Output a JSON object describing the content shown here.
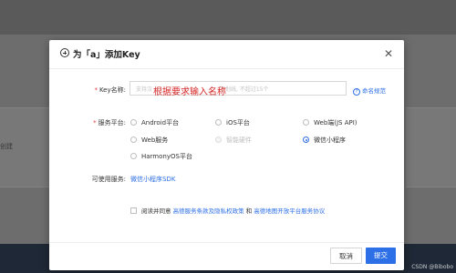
{
  "background": {
    "left_text": "创建"
  },
  "modal": {
    "title": "为「a」添加Key",
    "key_name": {
      "label": "Key名称:",
      "placeholder": "支持汉",
      "placeholder_tail": "下划线, 不超过15个",
      "overlay": "根据要求输入名称",
      "rule_link": "命名规范"
    },
    "platform": {
      "label": "服务平台:",
      "options": [
        {
          "label": "Android平台"
        },
        {
          "label": "iOS平台"
        },
        {
          "label": "Web端(JS API)"
        },
        {
          "label": "Web服务"
        },
        {
          "label": "智能硬件"
        },
        {
          "label": "微信小程序"
        },
        {
          "label": "HarmonyOS平台"
        }
      ],
      "selected": "微信小程序"
    },
    "available": {
      "label": "可使用服务:",
      "value": "微信小程序SDK"
    },
    "agreement": {
      "prefix": "阅读并同意",
      "link1": "高德服务条款及隐私权政策",
      "and": "和",
      "link2": "高德地图开放平台服务协议"
    },
    "buttons": {
      "cancel": "取消",
      "submit": "提交"
    }
  },
  "watermark": "CSDN @Bibobo",
  "colors": {
    "primary": "#2d6fe6",
    "required": "#e63939",
    "annotation": "#d62626"
  }
}
